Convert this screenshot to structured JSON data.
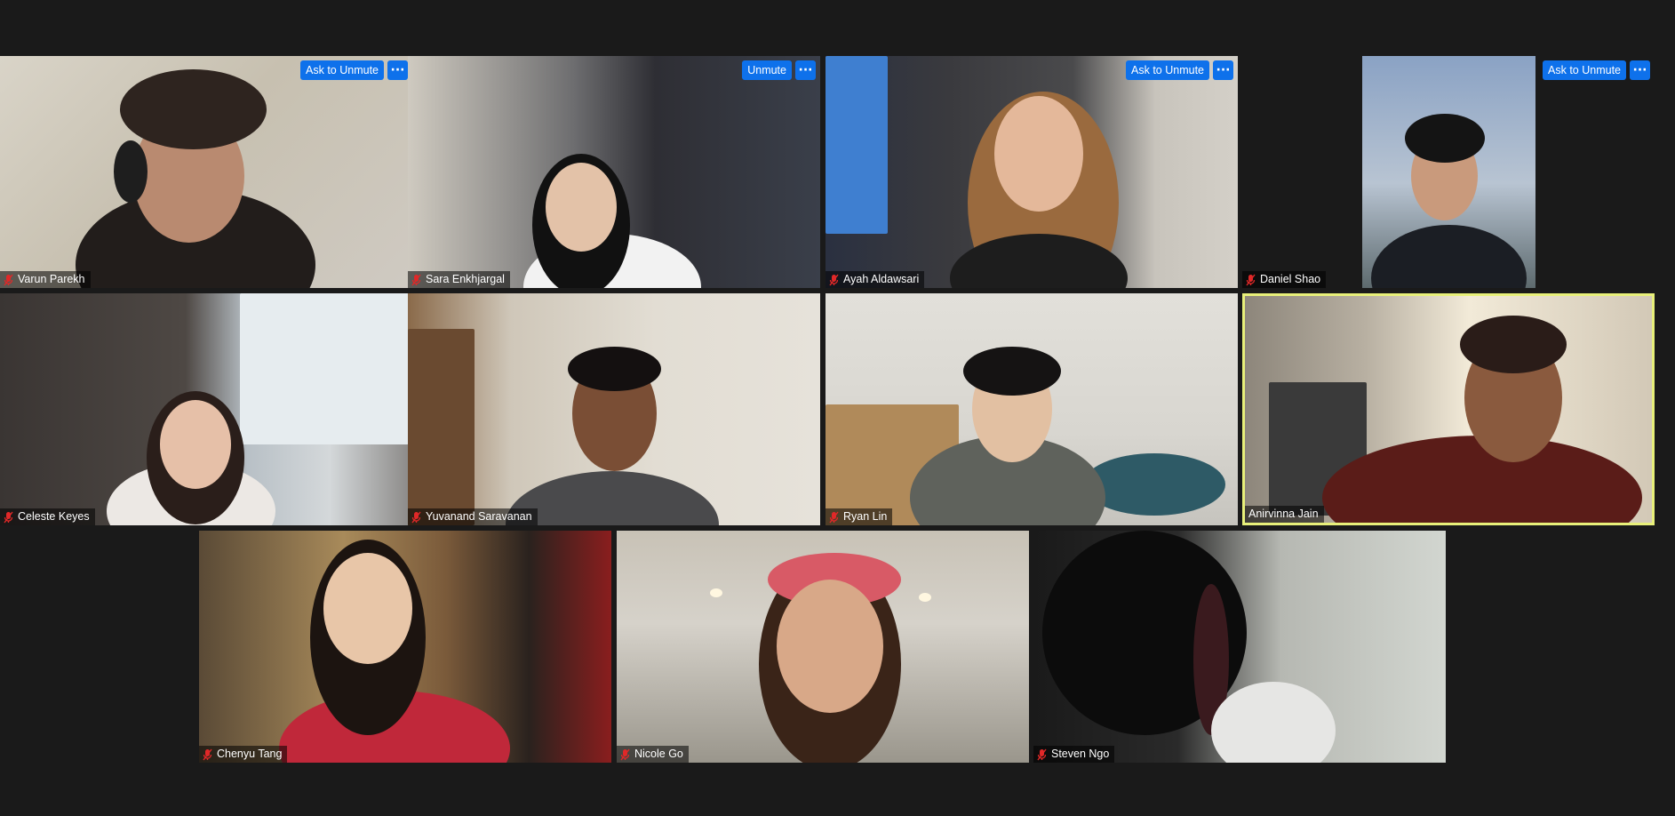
{
  "meeting": {
    "view": "Gallery View",
    "participants": [
      {
        "name": "Varun Parekh",
        "muted": true,
        "action_label": "Ask to Unmute",
        "more_label": "···"
      },
      {
        "name": "Sara Enkhjargal",
        "muted": true,
        "action_label": "Unmute",
        "more_label": "···"
      },
      {
        "name": "Ayah Aldawsari",
        "muted": true,
        "action_label": "Ask to Unmute",
        "more_label": "···"
      },
      {
        "name": "Daniel Shao",
        "muted": true,
        "action_label": "Ask to Unmute",
        "more_label": "···"
      },
      {
        "name": "Celeste Keyes",
        "muted": true
      },
      {
        "name": "Yuvanand Saravanan",
        "muted": true
      },
      {
        "name": "Ryan Lin",
        "muted": true
      },
      {
        "name": "Anirvinna Jain",
        "muted": false,
        "active_speaker": true
      },
      {
        "name": "Chenyu Tang",
        "muted": true
      },
      {
        "name": "Nicole Go",
        "muted": true
      },
      {
        "name": "Steven Ngo",
        "muted": true
      }
    ]
  },
  "colors": {
    "background": "#1a1a1a",
    "button_blue": "#0e71eb",
    "active_speaker_border": "#e8f07a",
    "muted_mic_red": "#e02828"
  }
}
